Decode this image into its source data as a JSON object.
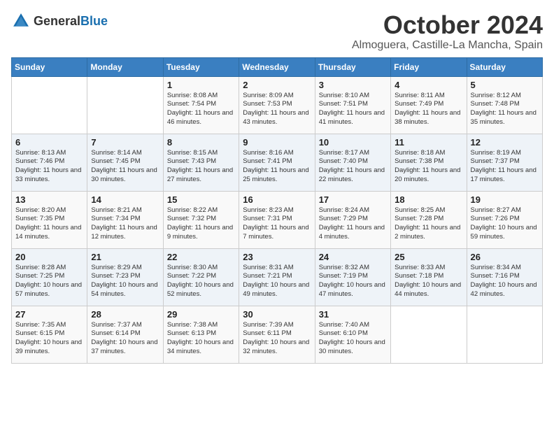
{
  "header": {
    "logo_general": "General",
    "logo_blue": "Blue",
    "month": "October 2024",
    "location": "Almoguera, Castille-La Mancha, Spain"
  },
  "weekdays": [
    "Sunday",
    "Monday",
    "Tuesday",
    "Wednesday",
    "Thursday",
    "Friday",
    "Saturday"
  ],
  "weeks": [
    [
      {
        "day": "",
        "info": ""
      },
      {
        "day": "",
        "info": ""
      },
      {
        "day": "1",
        "info": "Sunrise: 8:08 AM\nSunset: 7:54 PM\nDaylight: 11 hours and 46 minutes."
      },
      {
        "day": "2",
        "info": "Sunrise: 8:09 AM\nSunset: 7:53 PM\nDaylight: 11 hours and 43 minutes."
      },
      {
        "day": "3",
        "info": "Sunrise: 8:10 AM\nSunset: 7:51 PM\nDaylight: 11 hours and 41 minutes."
      },
      {
        "day": "4",
        "info": "Sunrise: 8:11 AM\nSunset: 7:49 PM\nDaylight: 11 hours and 38 minutes."
      },
      {
        "day": "5",
        "info": "Sunrise: 8:12 AM\nSunset: 7:48 PM\nDaylight: 11 hours and 35 minutes."
      }
    ],
    [
      {
        "day": "6",
        "info": "Sunrise: 8:13 AM\nSunset: 7:46 PM\nDaylight: 11 hours and 33 minutes."
      },
      {
        "day": "7",
        "info": "Sunrise: 8:14 AM\nSunset: 7:45 PM\nDaylight: 11 hours and 30 minutes."
      },
      {
        "day": "8",
        "info": "Sunrise: 8:15 AM\nSunset: 7:43 PM\nDaylight: 11 hours and 27 minutes."
      },
      {
        "day": "9",
        "info": "Sunrise: 8:16 AM\nSunset: 7:41 PM\nDaylight: 11 hours and 25 minutes."
      },
      {
        "day": "10",
        "info": "Sunrise: 8:17 AM\nSunset: 7:40 PM\nDaylight: 11 hours and 22 minutes."
      },
      {
        "day": "11",
        "info": "Sunrise: 8:18 AM\nSunset: 7:38 PM\nDaylight: 11 hours and 20 minutes."
      },
      {
        "day": "12",
        "info": "Sunrise: 8:19 AM\nSunset: 7:37 PM\nDaylight: 11 hours and 17 minutes."
      }
    ],
    [
      {
        "day": "13",
        "info": "Sunrise: 8:20 AM\nSunset: 7:35 PM\nDaylight: 11 hours and 14 minutes."
      },
      {
        "day": "14",
        "info": "Sunrise: 8:21 AM\nSunset: 7:34 PM\nDaylight: 11 hours and 12 minutes."
      },
      {
        "day": "15",
        "info": "Sunrise: 8:22 AM\nSunset: 7:32 PM\nDaylight: 11 hours and 9 minutes."
      },
      {
        "day": "16",
        "info": "Sunrise: 8:23 AM\nSunset: 7:31 PM\nDaylight: 11 hours and 7 minutes."
      },
      {
        "day": "17",
        "info": "Sunrise: 8:24 AM\nSunset: 7:29 PM\nDaylight: 11 hours and 4 minutes."
      },
      {
        "day": "18",
        "info": "Sunrise: 8:25 AM\nSunset: 7:28 PM\nDaylight: 11 hours and 2 minutes."
      },
      {
        "day": "19",
        "info": "Sunrise: 8:27 AM\nSunset: 7:26 PM\nDaylight: 10 hours and 59 minutes."
      }
    ],
    [
      {
        "day": "20",
        "info": "Sunrise: 8:28 AM\nSunset: 7:25 PM\nDaylight: 10 hours and 57 minutes."
      },
      {
        "day": "21",
        "info": "Sunrise: 8:29 AM\nSunset: 7:23 PM\nDaylight: 10 hours and 54 minutes."
      },
      {
        "day": "22",
        "info": "Sunrise: 8:30 AM\nSunset: 7:22 PM\nDaylight: 10 hours and 52 minutes."
      },
      {
        "day": "23",
        "info": "Sunrise: 8:31 AM\nSunset: 7:21 PM\nDaylight: 10 hours and 49 minutes."
      },
      {
        "day": "24",
        "info": "Sunrise: 8:32 AM\nSunset: 7:19 PM\nDaylight: 10 hours and 47 minutes."
      },
      {
        "day": "25",
        "info": "Sunrise: 8:33 AM\nSunset: 7:18 PM\nDaylight: 10 hours and 44 minutes."
      },
      {
        "day": "26",
        "info": "Sunrise: 8:34 AM\nSunset: 7:16 PM\nDaylight: 10 hours and 42 minutes."
      }
    ],
    [
      {
        "day": "27",
        "info": "Sunrise: 7:35 AM\nSunset: 6:15 PM\nDaylight: 10 hours and 39 minutes."
      },
      {
        "day": "28",
        "info": "Sunrise: 7:37 AM\nSunset: 6:14 PM\nDaylight: 10 hours and 37 minutes."
      },
      {
        "day": "29",
        "info": "Sunrise: 7:38 AM\nSunset: 6:13 PM\nDaylight: 10 hours and 34 minutes."
      },
      {
        "day": "30",
        "info": "Sunrise: 7:39 AM\nSunset: 6:11 PM\nDaylight: 10 hours and 32 minutes."
      },
      {
        "day": "31",
        "info": "Sunrise: 7:40 AM\nSunset: 6:10 PM\nDaylight: 10 hours and 30 minutes."
      },
      {
        "day": "",
        "info": ""
      },
      {
        "day": "",
        "info": ""
      }
    ]
  ]
}
